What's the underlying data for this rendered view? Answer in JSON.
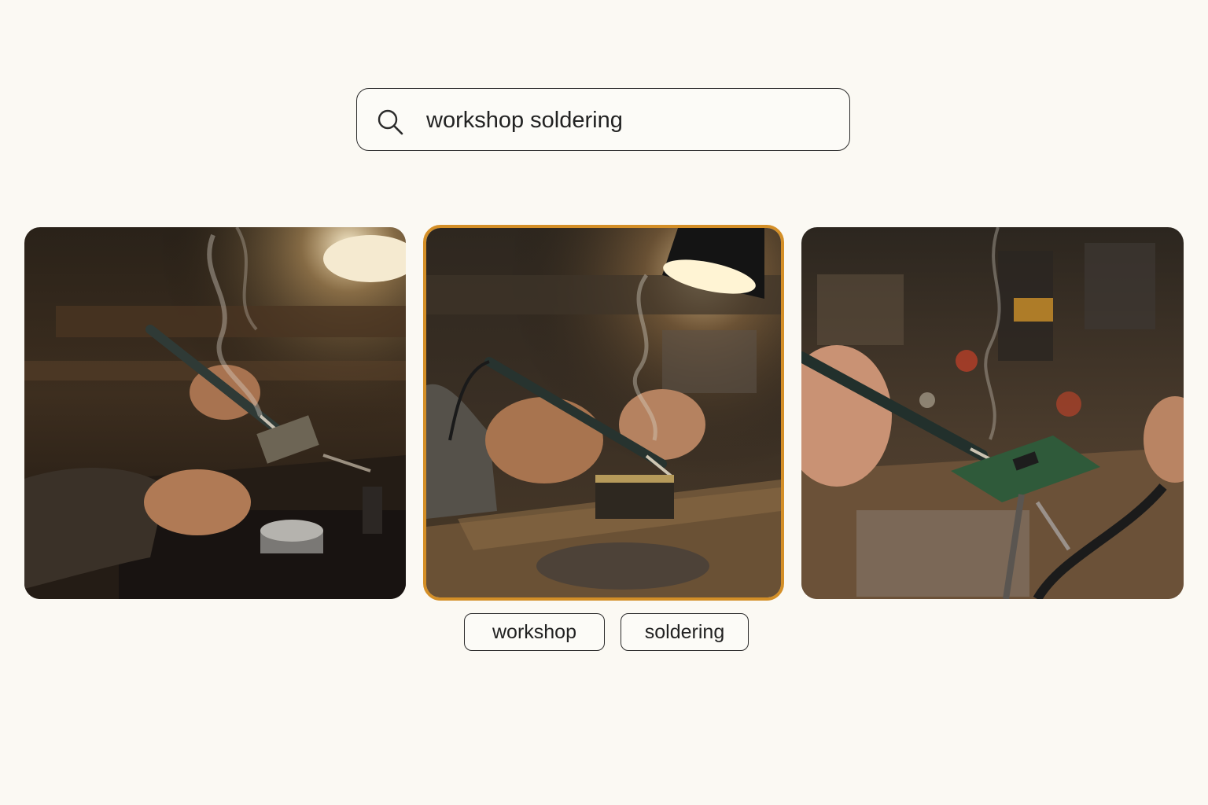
{
  "search": {
    "value": "workshop soldering",
    "icon": "search-icon"
  },
  "results": [
    {
      "subject": "hands soldering a component held in helping hands beside a solder spool under a desk lamp",
      "selected": false
    },
    {
      "subject": "hands soldering a circuit board under a black desk lamp",
      "selected": true
    },
    {
      "subject": "hand holding soldering iron on green circuit board in a helping-hands clamp",
      "selected": false
    }
  ],
  "tags": [
    "workshop",
    "soldering"
  ],
  "colors": {
    "background": "#fbf9f3",
    "selection_border": "#d48f27",
    "outline": "#2b2b2b"
  }
}
